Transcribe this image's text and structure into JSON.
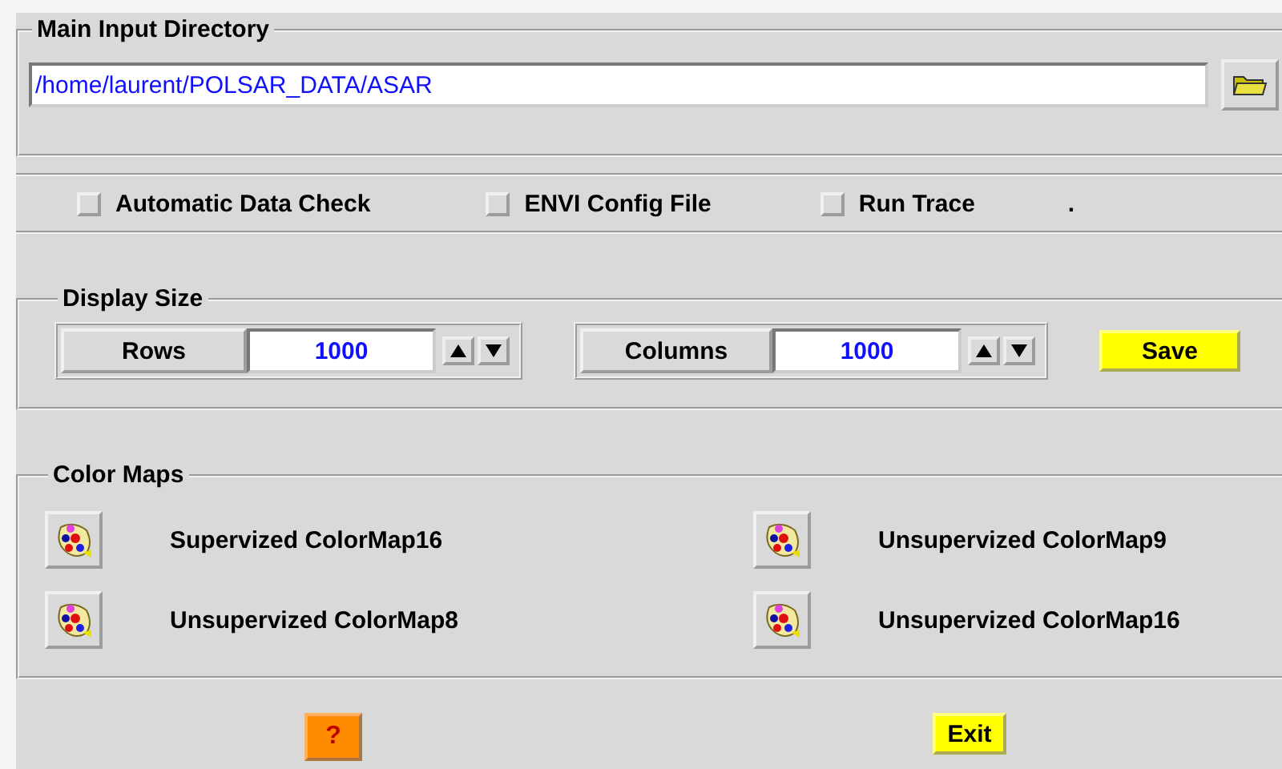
{
  "input_directory": {
    "title": "Main Input Directory",
    "path": "/home/laurent/POLSAR_DATA/ASAR"
  },
  "options": [
    {
      "label": "Automatic Data Check",
      "checked": false
    },
    {
      "label": "ENVI Config File",
      "checked": false
    },
    {
      "label": "Run Trace",
      "checked": false
    }
  ],
  "options_trailing": ".",
  "display_size": {
    "title": "Display Size",
    "fields": [
      {
        "label": "Rows",
        "value": "1000"
      },
      {
        "label": "Columns",
        "value": "1000"
      }
    ],
    "save": "Save"
  },
  "color_maps": {
    "title": "Color Maps",
    "items": [
      "Supervized ColorMap16",
      "Unsupervized ColorMap9",
      "Unsupervized ColorMap8",
      "Unsupervized ColorMap16"
    ]
  },
  "footer": {
    "help": "?",
    "exit": "Exit"
  }
}
